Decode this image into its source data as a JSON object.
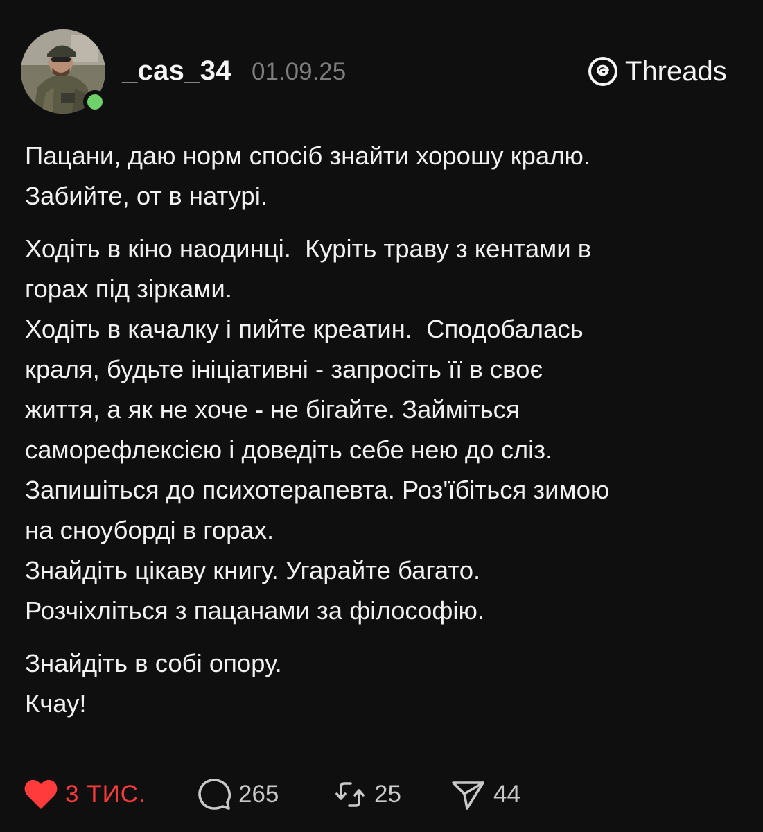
{
  "header": {
    "username": "_cas_34",
    "date": "01.09.25",
    "platform_label": "Threads",
    "online_dot_color": "#6ed16a"
  },
  "post": {
    "paragraphs": [
      "Пацани, даю норм спосіб знайти хорошу кралю.\nЗабийте, от в натурі.",
      "Ходіть в кіно наодинці.  Куріть траву з кентами в\nгорах під зірками.",
      "Ходіть в качалку і пийте креатин.  Сподобалась\nкраля, будьте ініціативні - запросіть її в своє\nжиття, а як не хоче - не бігайте. Займіться\nсаморефлексією і доведіть себе нею до сліз.",
      "Запишіться до психотерапевта. Роз'їбіться зимою\nна сноуборді в горах.",
      "Знайдіть цікаву книгу. Угарайте багато.\nРозчіхліться з пацанами за філософію.",
      "Знайдіть в собі опору.\nКчау!"
    ]
  },
  "actions": {
    "like": {
      "count": "3 ТИС.",
      "icon": "heart-filled-icon",
      "color": "#ff3b3b"
    },
    "reply": {
      "count": "265",
      "icon": "comment-bubble-icon"
    },
    "repost": {
      "count": "25",
      "icon": "repost-icon"
    },
    "share": {
      "count": "44",
      "icon": "send-icon"
    }
  }
}
